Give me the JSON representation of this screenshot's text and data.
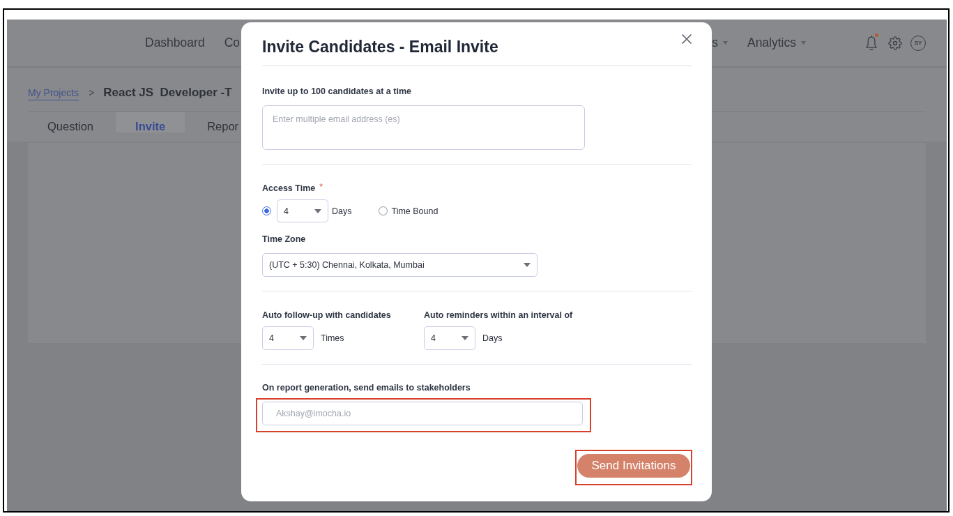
{
  "app": {
    "nav": [
      {
        "label": "Dashboard",
        "dropdown": false
      },
      {
        "label": "Co",
        "dropdown": false
      },
      {
        "label": "s",
        "dropdown": true
      },
      {
        "label": "Analytics",
        "dropdown": true
      }
    ],
    "notifications": {
      "unread": true
    },
    "avatar": {
      "initials": "SY"
    },
    "breadcrumb": {
      "link": "My Projects",
      "separator": ">",
      "title": "React JS  Developer -T"
    },
    "tabs": [
      {
        "label": "Question",
        "selected": false
      },
      {
        "label": "Invite",
        "selected": true
      },
      {
        "label": "Repor",
        "selected": false
      }
    ]
  },
  "modal": {
    "title": "Invite Candidates - Email Invite",
    "emails": {
      "label": "Invite up to 100 candidates at a time",
      "placeholder": "Enter multiple email address (es)"
    },
    "access_time": {
      "label": "Access Time",
      "required_mark": "*",
      "options": [
        {
          "kind": "duration",
          "selected": true,
          "value": "4",
          "unit": "Days"
        },
        {
          "kind": "time_bound",
          "selected": false,
          "label": "Time Bound"
        }
      ]
    },
    "time_zone": {
      "label": "Time Zone",
      "value": "(UTC + 5:30) Chennai, Kolkata, Mumbai"
    },
    "follow_up": [
      {
        "label": "Auto follow-up with candidates",
        "value": "4",
        "unit": "Times"
      },
      {
        "label": "Auto reminders within an interval of",
        "value": "4",
        "unit": "Days"
      }
    ],
    "stakeholders": {
      "label": "On report generation, send emails to stakeholders",
      "placeholder": "Akshay@imocha.io",
      "highlighted": true
    },
    "send_button": {
      "label": "Send Invitations",
      "highlighted": true
    }
  }
}
